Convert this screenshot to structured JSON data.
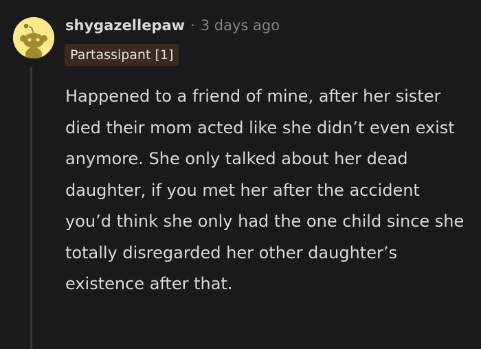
{
  "comment": {
    "username": "shygazellepaw",
    "separator": "·",
    "timestamp": "3 days ago",
    "flair": "Partassipant [1]",
    "body": "Happened to a friend of mine, after her sister died their mom acted like she didn’t even exist anymore. She only talked about her dead daughter, if you met her after the accident you’d think she only had the one child since she totally disregarded her other daughter’s existence after that.",
    "avatar_icon": "snoo-avatar-icon"
  },
  "colors": {
    "background": "#1a1a1b",
    "text": "#d7dadc",
    "muted": "#818384",
    "flair_bg": "#3a2a22",
    "avatar_bg": "#fce98a",
    "thread_line": "#343536"
  }
}
